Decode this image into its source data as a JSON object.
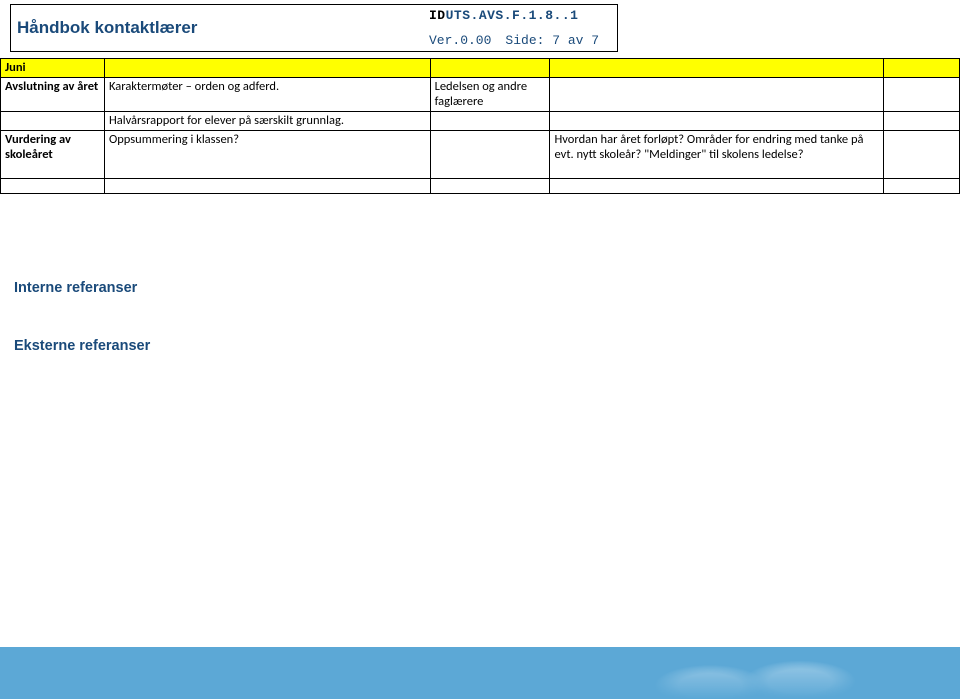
{
  "header": {
    "title": "Håndbok kontaktlærer",
    "doc_id_prefix": "ID",
    "doc_id_rest": "UTS.AVS.F.1.8..1",
    "version_label": "Ver.0.00",
    "page_label": "Side: 7 av 7"
  },
  "table": {
    "month": "Juni",
    "rows": [
      {
        "c1": "Avslutning av året",
        "c2": "Karaktermøter – orden og adferd.",
        "c3": "Ledelsen og andre faglærere",
        "c4": ""
      },
      {
        "c1": "",
        "c2": "Halvårsrapport for elever på særskilt grunnlag.",
        "c3": "",
        "c4": ""
      },
      {
        "c1": "Vurdering av skoleåret",
        "c2": "Oppsummering i klassen?",
        "c3": "",
        "c4": "Hvordan har året forløpt? Områder for endring  med tanke på evt. nytt skoleår? \"Meldinger\" til skolens ledelse?"
      }
    ]
  },
  "sections": {
    "internal": "Interne referanser",
    "external": "Eksterne referanser"
  }
}
